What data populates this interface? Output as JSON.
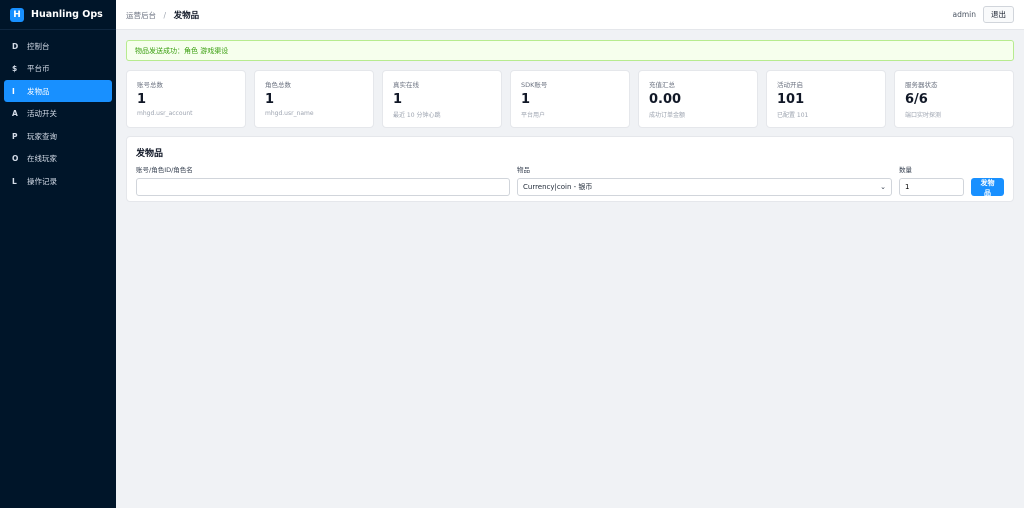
{
  "brand": {
    "logo_letter": "H",
    "name": "Huanling Ops"
  },
  "sidebar": {
    "items": [
      {
        "key": "D",
        "label": "控制台"
      },
      {
        "key": "$",
        "label": "平台币"
      },
      {
        "key": "I",
        "label": "发物品"
      },
      {
        "key": "A",
        "label": "活动开关"
      },
      {
        "key": "P",
        "label": "玩家查询"
      },
      {
        "key": "O",
        "label": "在线玩家"
      },
      {
        "key": "L",
        "label": "操作记录"
      }
    ],
    "active_index": 2
  },
  "header": {
    "breadcrumb_parent": "运营后台",
    "breadcrumb_sep": "/",
    "breadcrumb_current": "发物品",
    "user": "admin",
    "logout_label": "退出"
  },
  "alert": {
    "text": "物品发送成功：角色 游戏渠设"
  },
  "stats": [
    {
      "label": "账号总数",
      "value": "1",
      "sub": "mhgd.usr_account"
    },
    {
      "label": "角色总数",
      "value": "1",
      "sub": "mhgd.usr_name"
    },
    {
      "label": "真实在线",
      "value": "1",
      "sub": "最近 10 分钟心跳"
    },
    {
      "label": "SDK账号",
      "value": "1",
      "sub": "平台用户"
    },
    {
      "label": "充值汇总",
      "value": "0.00",
      "sub": "成功订单金额"
    },
    {
      "label": "活动开启",
      "value": "101",
      "sub": "已配置 101"
    },
    {
      "label": "服务器状态",
      "value": "6/6",
      "sub": "端口实时探测"
    }
  ],
  "form": {
    "title": "发物品",
    "account_label": "账号/角色ID/角色名",
    "account_value": "",
    "item_label": "物品",
    "item_selected": "Currency|coin - 银币",
    "qty_label": "数量",
    "qty_value": "1",
    "submit_label": "发物品"
  }
}
